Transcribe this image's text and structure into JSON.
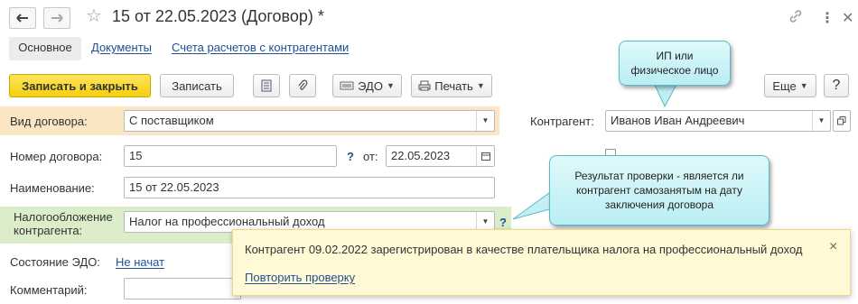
{
  "window": {
    "title": "15 от 22.05.2023 (Договор) *"
  },
  "tabs": [
    {
      "label": "Основное"
    },
    {
      "label": "Документы"
    },
    {
      "label": "Счета расчетов с контрагентами"
    }
  ],
  "toolbar": {
    "save_close": "Записать и закрыть",
    "save": "Записать",
    "edo": "ЭДО",
    "print": "Печать",
    "more": "Еще"
  },
  "form": {
    "contract_type_label": "Вид договора:",
    "contract_type_value": "С поставщиком",
    "number_label": "Номер договора:",
    "number_value": "15",
    "help": "?",
    "date_label": "от:",
    "date_value": "22.05.2023",
    "name_label": "Наименование:",
    "name_value": "15 от 22.05.2023",
    "tax_label_1": "Налогообложение",
    "tax_label_2": "контрагента:",
    "tax_value": "Налог на профессиональный доход",
    "edo_state_label": "Состояние ЭДО:",
    "edo_state_value": "Не начат",
    "comment_label": "Комментарий:",
    "counterparty_label": "Контрагент:",
    "counterparty_value": "Иванов Иван Андреевич"
  },
  "callouts": {
    "top_line1": "ИП или",
    "top_line2": "физическое лицо",
    "mid_line1": "Результат проверки - является ли",
    "mid_line2": "контрагент самозанятым на дату",
    "mid_line3": "заключения договора"
  },
  "notification": {
    "message": "Контрагент 09.02.2022 зарегистрирован в качестве плательщика налога на профессиональный доход",
    "repeat_link": "Повторить проверку",
    "close": "×"
  },
  "colors": {
    "accent_yellow": "#f5cf12",
    "highlight_orange": "#fbe6c3",
    "highlight_green": "#dbeec9",
    "link_blue": "#1f4f93",
    "callout_cyan": "#b9eef3",
    "notification_bg": "#fff9d6"
  }
}
